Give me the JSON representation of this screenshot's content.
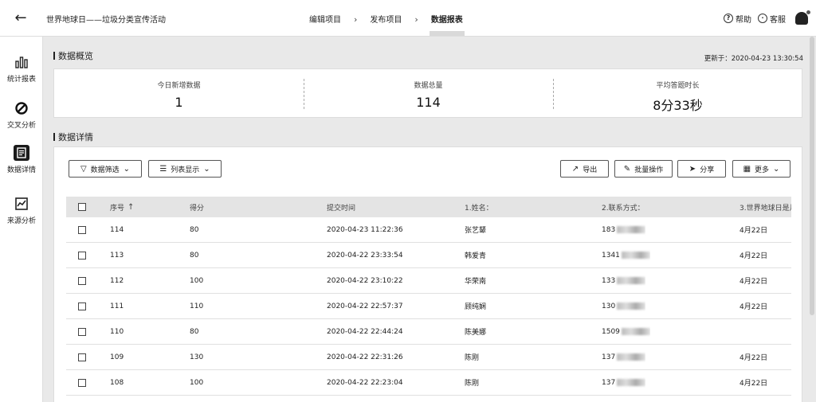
{
  "header": {
    "project_title": "世界地球日——垃圾分类宣传活动",
    "steps": [
      "编辑项目",
      "发布项目",
      "数据报表"
    ],
    "help": "帮助",
    "service": "客服"
  },
  "sidebar": {
    "items": [
      {
        "label": "统计报表",
        "icon": "bar-chart-icon"
      },
      {
        "label": "交叉分析",
        "icon": "cross-circle-icon"
      },
      {
        "label": "数据详情",
        "icon": "document-icon"
      },
      {
        "label": "来源分析",
        "icon": "trend-chart-icon"
      }
    ]
  },
  "overview": {
    "title": "数据概览",
    "updated": "更新于：2020-04-23 13:30:54",
    "stats": [
      {
        "label": "今日新增数据",
        "value": "1"
      },
      {
        "label": "数据总量",
        "value": "114"
      },
      {
        "label": "平均答题时长",
        "value": "8分33秒"
      }
    ]
  },
  "detail": {
    "title": "数据详情",
    "filter": "数据筛选",
    "list_display": "列表显示",
    "export": "导出",
    "batch": "批量操作",
    "share": "分享",
    "more": "更多"
  },
  "table": {
    "columns": [
      "序号",
      "得分",
      "提交时间",
      "1.姓名：",
      "2.联系方式：",
      "3.世界地球日是月"
    ],
    "rows": [
      {
        "id": "114",
        "score": "80",
        "time": "2020-04-23 11:22:36",
        "name": "张艺颦",
        "phone": "183",
        "date": "4月22日"
      },
      {
        "id": "113",
        "score": "80",
        "time": "2020-04-22 23:33:54",
        "name": "韩爱青",
        "phone": "1341",
        "date": "4月22日"
      },
      {
        "id": "112",
        "score": "100",
        "time": "2020-04-22 23:10:22",
        "name": "华荣南",
        "phone": "133",
        "date": "4月22日"
      },
      {
        "id": "111",
        "score": "110",
        "time": "2020-04-22 22:57:37",
        "name": "顾纯娴",
        "phone": "130",
        "date": "4月22日"
      },
      {
        "id": "110",
        "score": "80",
        "time": "2020-04-22 22:44:24",
        "name": "陈美娜",
        "phone": "1509",
        "date": ""
      },
      {
        "id": "109",
        "score": "130",
        "time": "2020-04-22 22:31:26",
        "name": "陈刚",
        "phone": "137",
        "date": "4月22日"
      },
      {
        "id": "108",
        "score": "100",
        "time": "2020-04-22 22:23:04",
        "name": "陈刚",
        "phone": "137",
        "date": "4月22日"
      }
    ]
  }
}
